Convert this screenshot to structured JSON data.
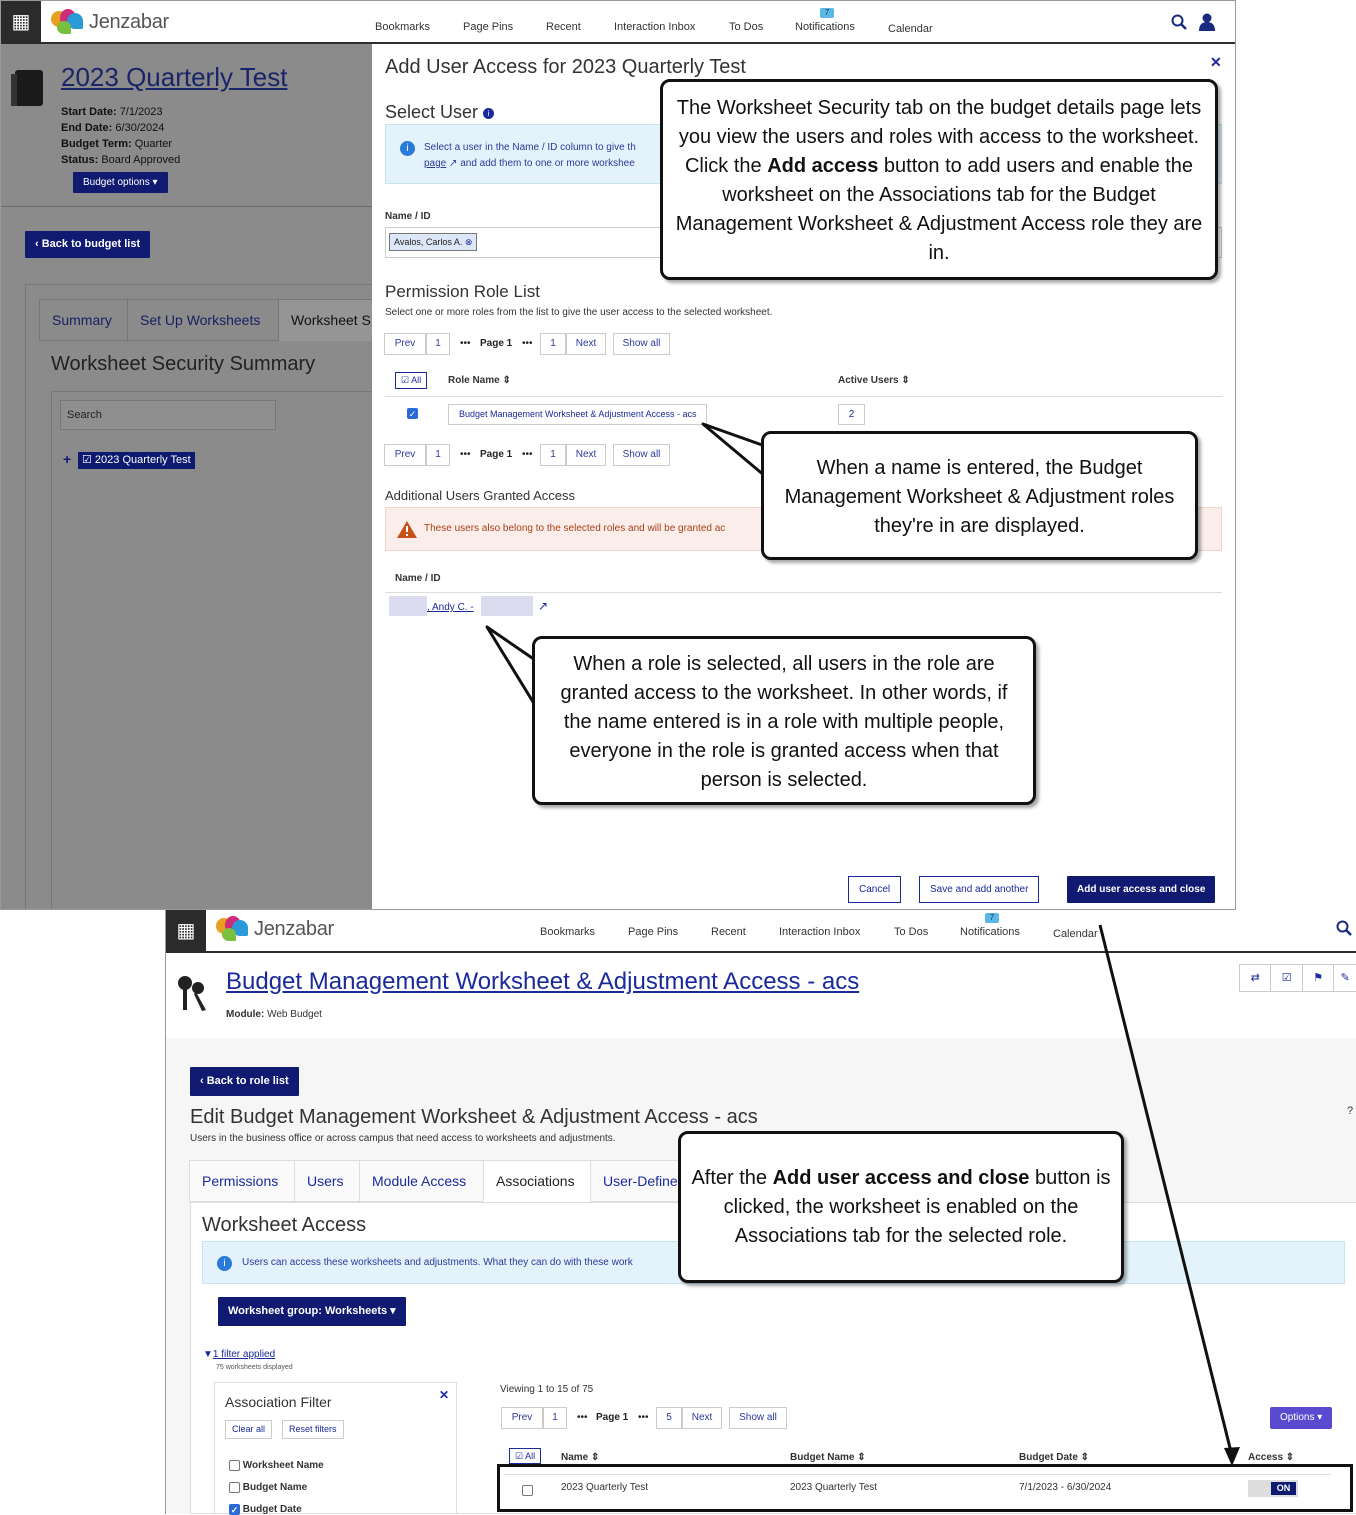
{
  "top": {
    "app_name": "Jenzabar",
    "nav": [
      "Bookmarks",
      "Page Pins",
      "Recent",
      "Interaction Inbox",
      "To Dos",
      "Notifications",
      "Calendar"
    ],
    "notifications_badge": "7",
    "budget": {
      "title": "2023 Quarterly Test",
      "start_label": "Start Date:",
      "start": "7/1/2023",
      "end_label": "End Date:",
      "end": "6/30/2024",
      "term_label": "Budget Term:",
      "term": "Quarter",
      "status_label": "Status:",
      "status": "Board Approved",
      "options": "Budget options"
    },
    "back": "Back to budget list",
    "tabs": [
      "Summary",
      "Set Up Worksheets",
      "Worksheet S"
    ],
    "section": "Worksheet Security Summary",
    "search_placeholder": "Search",
    "tree_item": "2023 Quarterly Test"
  },
  "modal": {
    "title": "Add User Access for 2023 Quarterly Test",
    "select_user": "Select User",
    "info_line1": "Select a user in the Name / ID column to give th",
    "info_link": "page",
    "info_line2": "and add them to one or more workshee",
    "name_label": "Name / ID",
    "name_value": "Avalos, Carlos A.",
    "perm_title": "Permission Role List",
    "perm_desc": "Select one or more roles from the list to give the user access to the selected worksheet.",
    "pager": {
      "prev": "Prev",
      "first": "1",
      "page": "Page 1",
      "last": "1",
      "next": "Next",
      "showall": "Show all"
    },
    "all": "All",
    "col_role": "Role Name",
    "col_active": "Active Users",
    "role_name": "Budget Management Worksheet & Adjustment Access - acs",
    "role_users": "2",
    "additional_title": "Additional Users Granted Access",
    "warning": "These users also belong to the selected roles and will be granted ac",
    "add_col": "Name / ID",
    "add_user": ", Andy C. -",
    "cancel": "Cancel",
    "save_another": "Save and add another",
    "add_close": "Add user access and close"
  },
  "callouts": {
    "c1_a": "The Worksheet Security tab on the budget details page lets you view the users and roles with access to the worksheet. Click the ",
    "c1_b": "Add access",
    "c1_c": " button to add users and enable the worksheet on the Associations tab for the Budget Management Worksheet & Adjustment Access role they are in.",
    "c2": "When a name is entered, the Budget Management Worksheet & Adjustment roles they're in are displayed.",
    "c3": "When a role is selected, all users in the role are granted access to the worksheet. In other words, if the name entered is in a role with multiple people, everyone in the role is granted access when that person is selected.",
    "c4_a": "After the ",
    "c4_b": "Add user access and close",
    "c4_c": " button is clicked, the worksheet is enabled on the Associations tab for the selected role."
  },
  "bottom": {
    "app_name": "Jenzabar",
    "nav": [
      "Bookmarks",
      "Page Pins",
      "Recent",
      "Interaction Inbox",
      "To Dos",
      "Notifications",
      "Calendar"
    ],
    "notifications_badge": "7",
    "title": "Budget Management Worksheet & Adjustment Access - acs",
    "module_label": "Module:",
    "module": "Web Budget",
    "back": "Back to role list",
    "edit_title": "Edit Budget Management Worksheet & Adjustment Access - acs",
    "edit_desc": "Users in the business office or across campus that need access to worksheets and adjustments.",
    "help": "?",
    "tabs": [
      "Permissions",
      "Users",
      "Module Access",
      "Associations",
      "User-Define"
    ],
    "wa_title": "Worksheet Access",
    "wa_info": "Users can access these worksheets and adjustments. What they can do with these work",
    "group_btn": "Worksheet group: Worksheets",
    "filter_link": "1 filter applied",
    "filter_count": "75 worksheets displayed",
    "assoc_filter": "Association Filter",
    "clear_all": "Clear all",
    "reset_filters": "Reset filters",
    "filters": [
      {
        "label": "Worksheet Name",
        "checked": false
      },
      {
        "label": "Budget Name",
        "checked": false
      },
      {
        "label": "Budget Date",
        "checked": true
      }
    ],
    "viewing": "Viewing 1 to 15 of 75",
    "pager": {
      "prev": "Prev",
      "first": "1",
      "page": "Page 1",
      "last": "5",
      "next": "Next",
      "showall": "Show all"
    },
    "options": "Options",
    "all": "All",
    "cols": [
      "Name",
      "Budget Name",
      "Budget Date",
      "Access"
    ],
    "row": {
      "name": "2023 Quarterly Test",
      "budget": "2023 Quarterly Test",
      "date": "7/1/2023 - 6/30/2024",
      "access": "ON"
    }
  }
}
